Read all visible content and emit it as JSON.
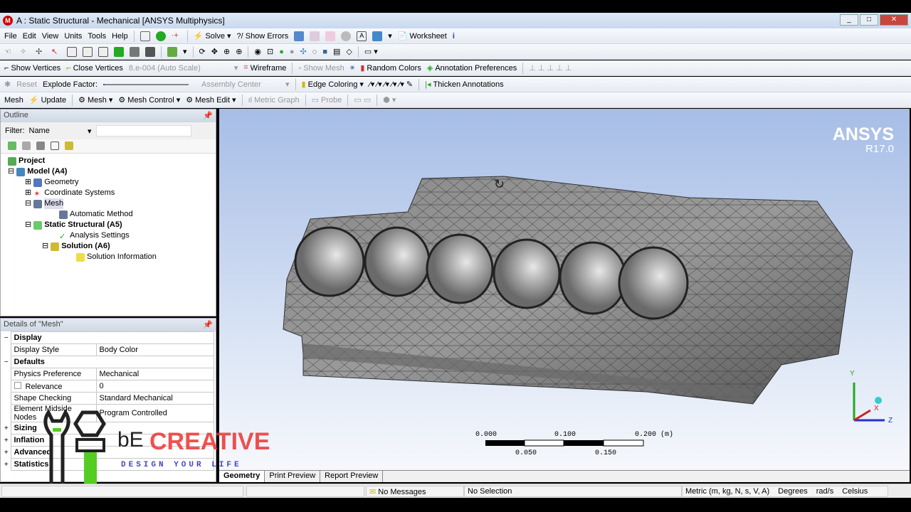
{
  "window": {
    "title": "A : Static Structural - Mechanical [ANSYS Multiphysics]",
    "logo": "M"
  },
  "menu": [
    "File",
    "Edit",
    "View",
    "Units",
    "Tools",
    "Help"
  ],
  "toolbar1": {
    "solve": "Solve",
    "show_errors": "?/ Show Errors",
    "worksheet": "Worksheet"
  },
  "toolbar3": {
    "show_vertices": "Show Vertices",
    "close_vertices": "Close Vertices",
    "scale": "8.e-004 (Auto Scale)",
    "wireframe": "Wireframe",
    "show_mesh": "Show Mesh",
    "random_colors": "Random Colors",
    "annotation_prefs": "Annotation Preferences"
  },
  "toolbar4": {
    "reset": "Reset",
    "explode_factor": "Explode Factor:",
    "assembly_center": "Assembly Center",
    "edge_coloring": "Edge Coloring",
    "thicken": "Thicken Annotations"
  },
  "toolbar5": {
    "mesh_label": "Mesh",
    "update": "Update",
    "mesh": "Mesh",
    "mesh_control": "Mesh Control",
    "mesh_edit": "Mesh Edit",
    "metric_graph": "Metric Graph",
    "probe": "Probe"
  },
  "outline": {
    "title": "Outline",
    "filter_label": "Filter:",
    "filter_value": "Name",
    "tree": [
      "Project",
      "Model (A4)",
      "Geometry",
      "Coordinate Systems",
      "Mesh",
      "Automatic Method",
      "Static Structural (A5)",
      "Analysis Settings",
      "Solution (A6)",
      "Solution Information"
    ]
  },
  "details": {
    "title": "Details of \"Mesh\"",
    "rows": [
      {
        "type": "group",
        "label": "Display",
        "sign": "−"
      },
      {
        "label": "Display Style",
        "value": "Body Color"
      },
      {
        "type": "group",
        "label": "Defaults",
        "sign": "−"
      },
      {
        "label": "Physics Preference",
        "value": "Mechanical"
      },
      {
        "label": "Relevance",
        "value": "0"
      },
      {
        "label": "Shape Checking",
        "value": "Standard Mechanical"
      },
      {
        "label": "Element Midside Nodes",
        "value": "Program Controlled"
      },
      {
        "type": "group",
        "label": "Sizing",
        "sign": "+"
      },
      {
        "type": "group",
        "label": "Inflation",
        "sign": "+"
      },
      {
        "type": "group",
        "label": "Advanced",
        "sign": "+"
      },
      {
        "type": "group",
        "label": "Statistics",
        "sign": "+"
      }
    ]
  },
  "viewport": {
    "brand": "ANSYS",
    "version": "R17.0",
    "scale": {
      "top": [
        "0.000",
        "0.100",
        "0.200 (m)"
      ],
      "bottom": [
        "0.050",
        "0.150"
      ]
    },
    "axes": [
      "Y",
      "X",
      "Z"
    ]
  },
  "watermark": {
    "text": "CREATIVE",
    "prefix": "bE",
    "tagline": "DESIGN YOUR LIFE"
  },
  "tabs": [
    "Geometry",
    "Print Preview",
    "Report Preview"
  ],
  "status": {
    "messages": "No Messages",
    "selection": "No Selection",
    "units": "Metric (m, kg, N, s, V, A)",
    "angle": "Degrees",
    "rot": "rad/s",
    "temp": "Celsius"
  }
}
